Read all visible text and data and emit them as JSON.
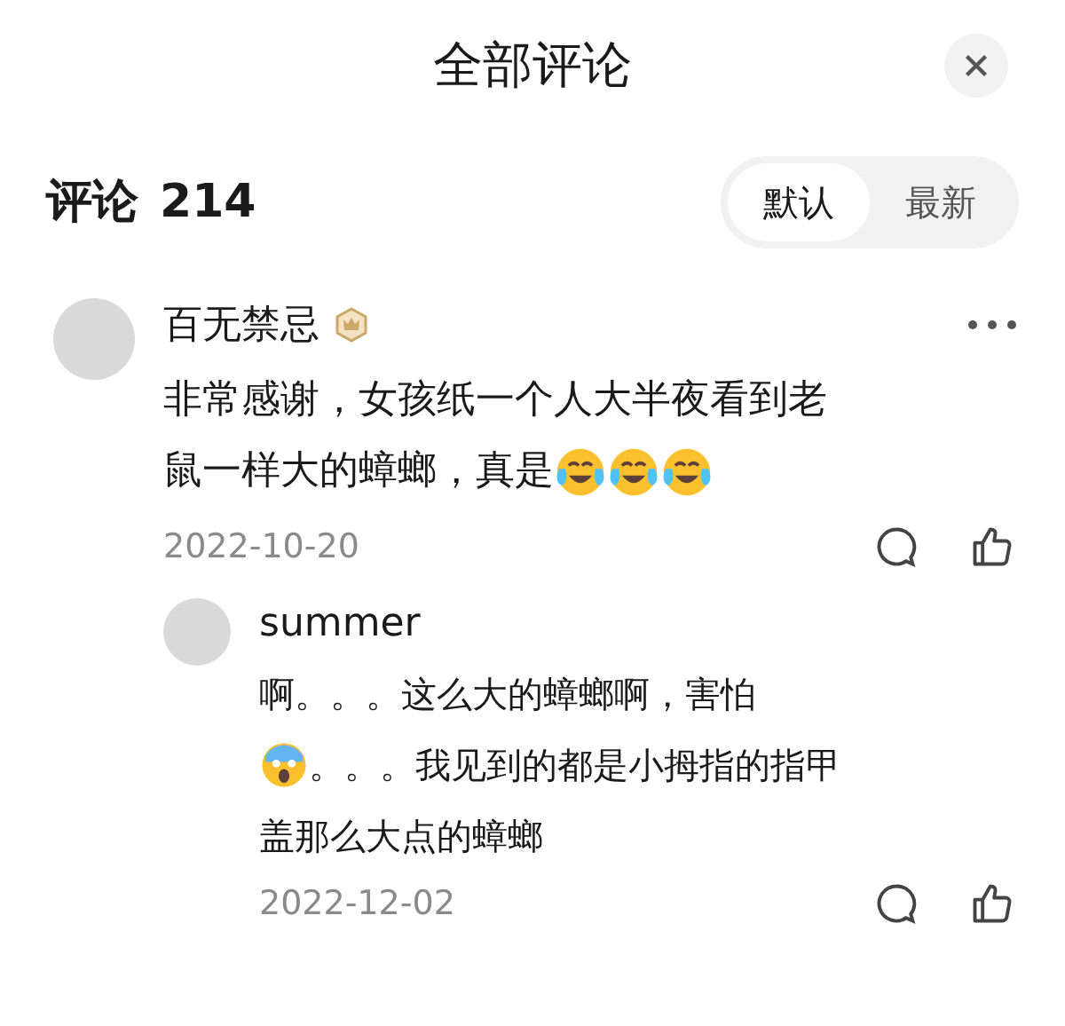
{
  "header": {
    "title": "全部评论"
  },
  "comments_bar": {
    "label": "评论",
    "count": "214",
    "sort_tabs": [
      {
        "label": "默认",
        "selected": true
      },
      {
        "label": "最新",
        "selected": false
      }
    ]
  },
  "comments": [
    {
      "author": "百无禁忌",
      "badge": true,
      "lines": [
        [
          {
            "kind": "text",
            "text": "非常感谢，女孩纸一个人大半夜看到老"
          }
        ],
        [
          {
            "kind": "text",
            "text": "鼠一样大的蟑螂，真是"
          },
          {
            "kind": "crying"
          },
          {
            "kind": "crying"
          },
          {
            "kind": "crying"
          }
        ]
      ],
      "date": "2022-10-20",
      "replies": [
        {
          "author": "summer",
          "lines": [
            [
              {
                "kind": "text",
                "text": "啊。。。这么大的蟑螂啊，害怕"
              }
            ],
            [
              {
                "kind": "scream"
              },
              {
                "kind": "text",
                "text": "。。。我见到的都是小拇指的指甲"
              }
            ],
            [
              {
                "kind": "text",
                "text": "盖那么大点的蟑螂"
              }
            ]
          ],
          "date": "2022-12-02"
        }
      ]
    }
  ]
}
